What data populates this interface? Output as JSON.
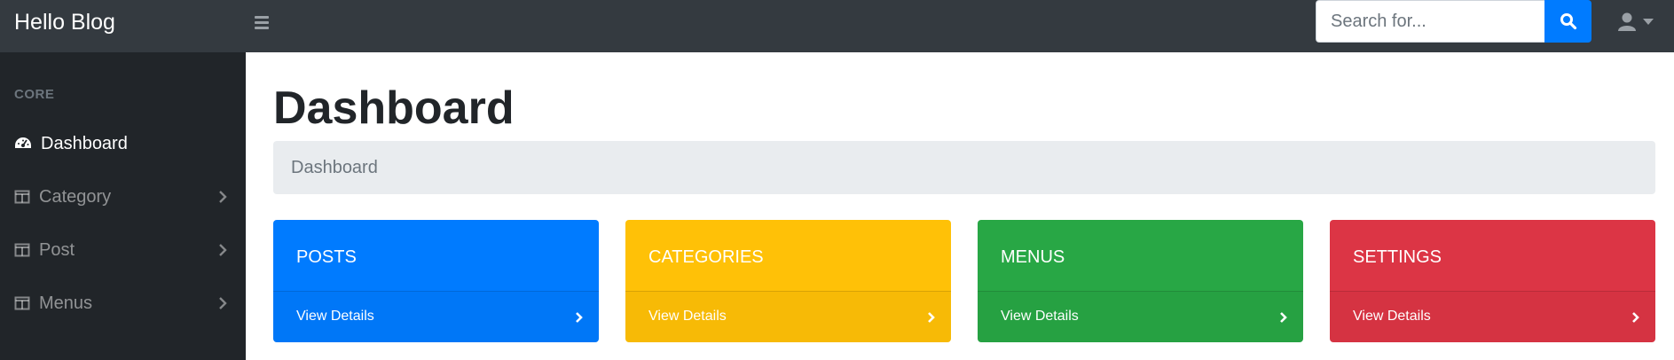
{
  "topnav": {
    "brand": "Hello Blog",
    "search_placeholder": "Search for...",
    "search_icon": "search-icon",
    "user_icon": "user-icon"
  },
  "sidebar": {
    "heading": "CORE",
    "items": [
      {
        "label": "Dashboard",
        "icon": "tachometer-icon",
        "active": true
      },
      {
        "label": "Category",
        "icon": "columns-icon",
        "expandable": true
      },
      {
        "label": "Post",
        "icon": "columns-icon",
        "expandable": true
      },
      {
        "label": "Menus",
        "icon": "columns-icon",
        "expandable": true
      }
    ]
  },
  "main": {
    "title": "Dashboard",
    "breadcrumb": "Dashboard",
    "cards": [
      {
        "title": "POSTS",
        "link": "View Details",
        "color": "#007bff"
      },
      {
        "title": "CATEGORIES",
        "link": "View Details",
        "color": "#ffc107"
      },
      {
        "title": "MENUS",
        "link": "View Details",
        "color": "#28a745"
      },
      {
        "title": "SETTINGS",
        "link": "View Details",
        "color": "#dc3545"
      }
    ]
  }
}
